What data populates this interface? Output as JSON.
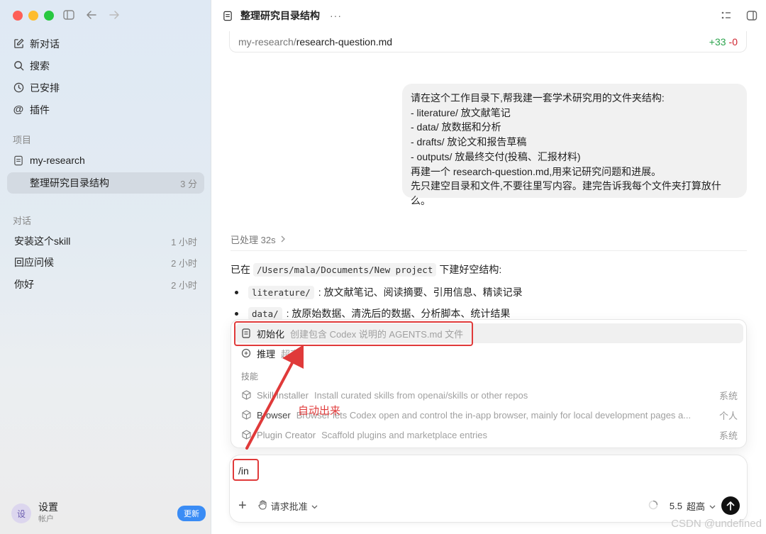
{
  "sidebar": {
    "nav": [
      {
        "label": "新对话",
        "icon": "edit-icon"
      },
      {
        "label": "搜索",
        "icon": "search-icon"
      },
      {
        "label": "已安排",
        "icon": "clock-icon"
      },
      {
        "label": "插件",
        "icon": "at-icon"
      }
    ],
    "projects_label": "项目",
    "project": {
      "name": "my-research",
      "icon": "folder-icon"
    },
    "active_thread": {
      "label": "整理研究目录结构",
      "time": "3 分"
    },
    "conversations_label": "对话",
    "conversations": [
      {
        "label": "安装这个skill",
        "time": "1 小时"
      },
      {
        "label": "回应问候",
        "time": "2 小时"
      },
      {
        "label": "你好",
        "time": "2 小时"
      }
    ],
    "account": {
      "avatar": "设",
      "name": "设置",
      "sub": "帐户",
      "update": "更新"
    }
  },
  "header": {
    "title": "整理研究目录结构",
    "more": "···"
  },
  "file_card": {
    "dir": "my-research/",
    "name": "research-question.md",
    "plus": "+33",
    "minus": "-0"
  },
  "user_message": {
    "lines": [
      "请在这个工作目录下,帮我建一套学术研究用的文件夹结构:",
      "- literature/ 放文献笔记",
      "- data/ 放数据和分析",
      "- drafts/ 放论文和报告草稿",
      "- outputs/ 放最终交付(投稿、汇报材料)",
      "再建一个 research-question.md,用来记研究问题和进展。",
      "先只建空目录和文件,不要往里写内容。建完告诉我每个文件夹打算放什么。"
    ]
  },
  "processed": "已处理 32s",
  "response": {
    "prefix": "已在",
    "path": "/Users/mala/Documents/New project",
    "suffix": "下建好空结构:",
    "bullets": [
      {
        "code": "literature/",
        "text": ": 放文献笔记、阅读摘要、引用信息、精读记录"
      },
      {
        "code": "data/",
        "text": ": 放原始数据、清洗后的数据、分析脚本、统计结果"
      }
    ]
  },
  "popup": {
    "commands": [
      {
        "title": "初始化",
        "desc": "创建包含 Codex 说明的 AGENTS.md 文件",
        "icon": "document-icon"
      },
      {
        "title": "推理",
        "desc": "超高",
        "icon": "brain-icon"
      }
    ],
    "skills_label": "技能",
    "skills": [
      {
        "title": "Skill Installer",
        "desc": "Install curated skills from openai/skills or other repos",
        "scope": "系统"
      },
      {
        "title": "Browser",
        "desc": "Browser lets Codex open and control the in-app browser, mainly for local development pages a...",
        "scope": "个人"
      },
      {
        "title": "Plugin Creator",
        "desc": "Scaffold plugins and marketplace entries",
        "scope": "系统"
      }
    ]
  },
  "composer": {
    "input": "/in",
    "approval": "请求批准",
    "model": "5.5",
    "effort": "超高"
  },
  "annotation": {
    "text": "自动出来",
    "color": "#e03a3a"
  },
  "watermark": "CSDN @undefined"
}
